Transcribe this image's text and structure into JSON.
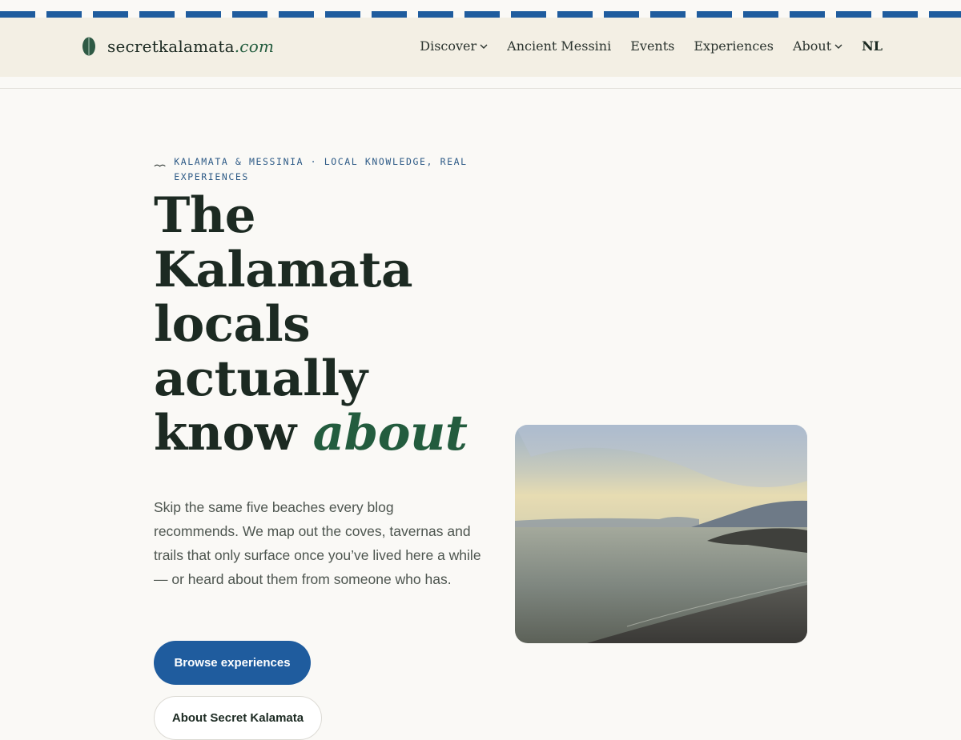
{
  "site": {
    "logo_name": "secretkalamata",
    "logo_tld": ".com"
  },
  "nav": {
    "items": [
      {
        "label": "Discover",
        "has_dropdown": true
      },
      {
        "label": "Ancient Messini",
        "has_dropdown": false
      },
      {
        "label": "Events",
        "has_dropdown": false
      },
      {
        "label": "Experiences",
        "has_dropdown": false
      },
      {
        "label": "About",
        "has_dropdown": true
      }
    ],
    "language": "NL"
  },
  "hero": {
    "eyebrow": "Kalamata & Messinia · Local knowledge, real experiences",
    "title_main": "The Kalamata locals actually know",
    "title_accent": "about",
    "lede": "Skip the same five beaches every blog recommends. We map out the coves, tavernas and trails that only surface once you’ve lived here a while — or heard about them from someone who has.",
    "primary_button": "Browse experiences",
    "secondary_button": "About Secret Kalamata",
    "photo_icon": "seaside-sunset-photo"
  },
  "colors": {
    "brand_blue": "#1f5c9e",
    "brand_green": "#235c3e",
    "ink": "#1c2a22",
    "header_bg": "#f3efe4",
    "page_bg": "#faf9f6"
  }
}
